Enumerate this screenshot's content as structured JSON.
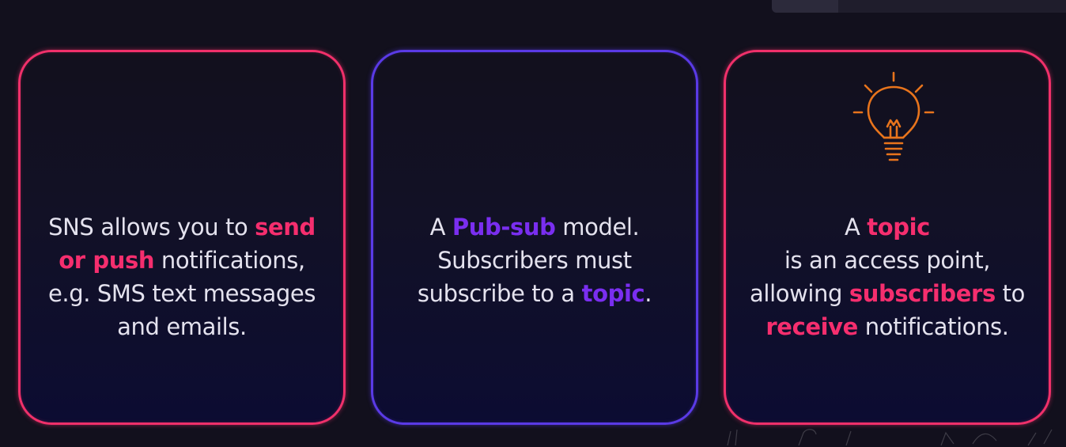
{
  "cards": [
    {
      "lines": [
        {
          "a": "SNS allows you to ",
          "b": "send"
        },
        {
          "a": "or push",
          "b": " notifications,"
        },
        {
          "a": "e.g. SMS text messages"
        },
        {
          "a": "and emails."
        }
      ]
    },
    {
      "lines": [
        {
          "a": "A ",
          "b": "Pub-sub",
          "c": " model."
        },
        {
          "a": "Subscribers must"
        },
        {
          "a": "subscribe to a ",
          "b": "topic",
          "c": "."
        }
      ]
    },
    {
      "icon": "lightbulb-icon",
      "lines": [
        {
          "a": "A ",
          "b": "topic"
        },
        {
          "a": "is an access point,"
        },
        {
          "a": "allowing ",
          "b": "subscribers",
          "c": " to"
        },
        {
          "a": "receive",
          "b": " notifications."
        }
      ]
    }
  ],
  "colors": {
    "background": "#12101d",
    "pink_accent": "#f52e6e",
    "purple_accent": "#7a2ef0",
    "blue_border": "#5a3ae6",
    "bulb_orange": "#e8741c",
    "text": "#e4e2ee"
  }
}
